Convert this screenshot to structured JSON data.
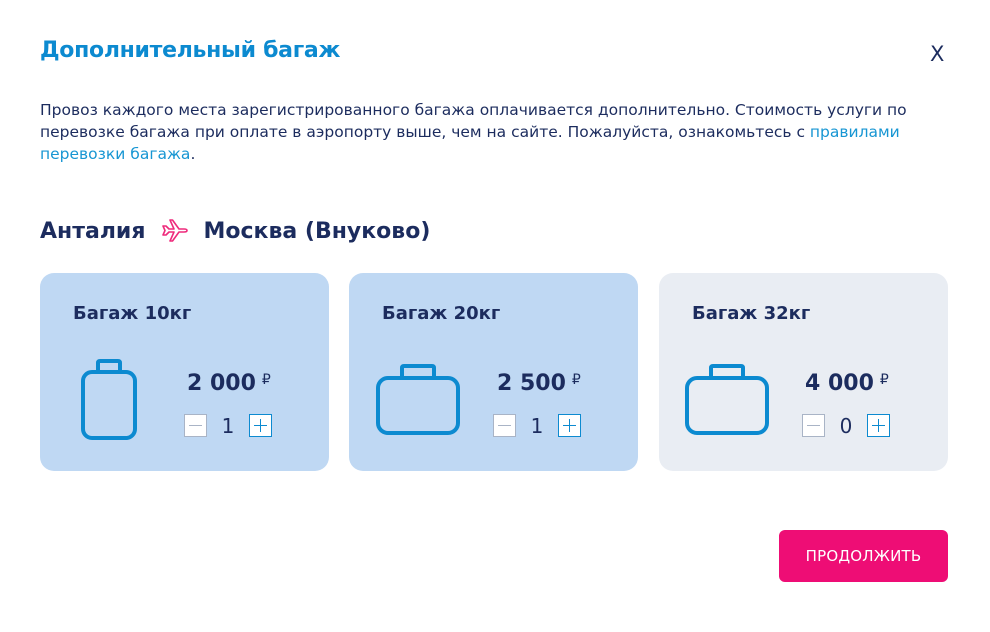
{
  "modal": {
    "title": "Дополнительный багаж",
    "close_label": "X"
  },
  "description": {
    "text": "Провоз каждого места зарегистрированного багажа оплачивается дополнительно. Стоимость услуги по перевозке багажа при оплате в аэропорту выше, чем на сайте. Пожалуйста, ознакомьтесь с ",
    "link_text": "правилами перевозки багажа",
    "suffix": "."
  },
  "route": {
    "from": "Анталия",
    "to": "Москва (Внуково)",
    "icon": "plane-icon"
  },
  "baggage_options": [
    {
      "title": "Багаж 10кг",
      "price": "2 000",
      "currency": "₽",
      "quantity": "1",
      "selected": true,
      "icon": "suitcase-upright-icon"
    },
    {
      "title": "Багаж 20кг",
      "price": "2 500",
      "currency": "₽",
      "quantity": "1",
      "selected": true,
      "icon": "suitcase-icon"
    },
    {
      "title": "Багаж 32кг",
      "price": "4 000",
      "currency": "₽",
      "quantity": "0",
      "selected": false,
      "icon": "suitcase-icon"
    }
  ],
  "actions": {
    "continue_label": "ПРОДОЛЖИТЬ"
  },
  "colors": {
    "accent_blue": "#0c8ad0",
    "text_dark": "#1c2c5e",
    "selected_card": "#bfd8f3",
    "unselected_card": "#e9edf3",
    "primary_button": "#ee0d75",
    "plane_icon": "#ee2a7b"
  }
}
